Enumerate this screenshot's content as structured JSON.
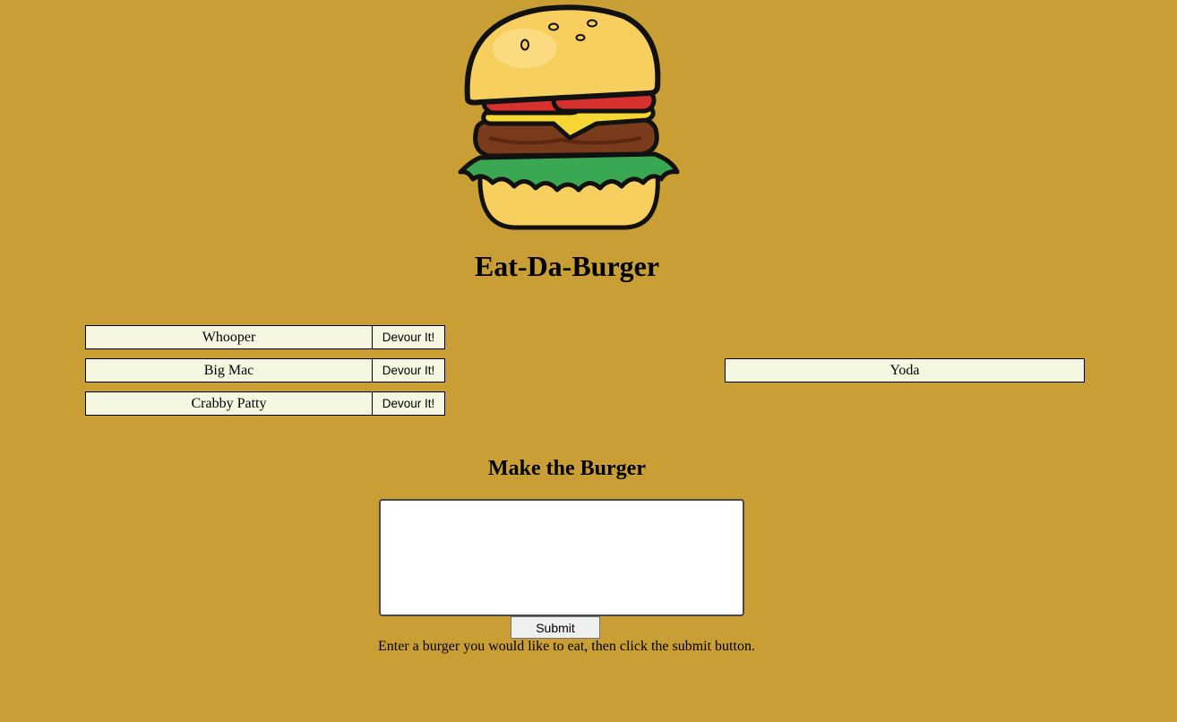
{
  "header": {
    "logo_icon": "burger-illustration",
    "title": "Eat-Da-Burger"
  },
  "uneaten_burgers": [
    {
      "name": "Whooper",
      "action_label": "Devour It!"
    },
    {
      "name": "Big Mac",
      "action_label": "Devour It!"
    },
    {
      "name": "Crabby Patty",
      "action_label": "Devour It!"
    }
  ],
  "devoured_burgers": [
    {
      "name": "Yoda"
    }
  ],
  "form": {
    "heading": "Make the Burger",
    "input_value": "",
    "submit_label": "Submit",
    "instructions": "Enter a burger you would like to eat, then click the submit button."
  },
  "colors": {
    "page_background": "#c99f35",
    "row_background": "#f5f7e1"
  }
}
